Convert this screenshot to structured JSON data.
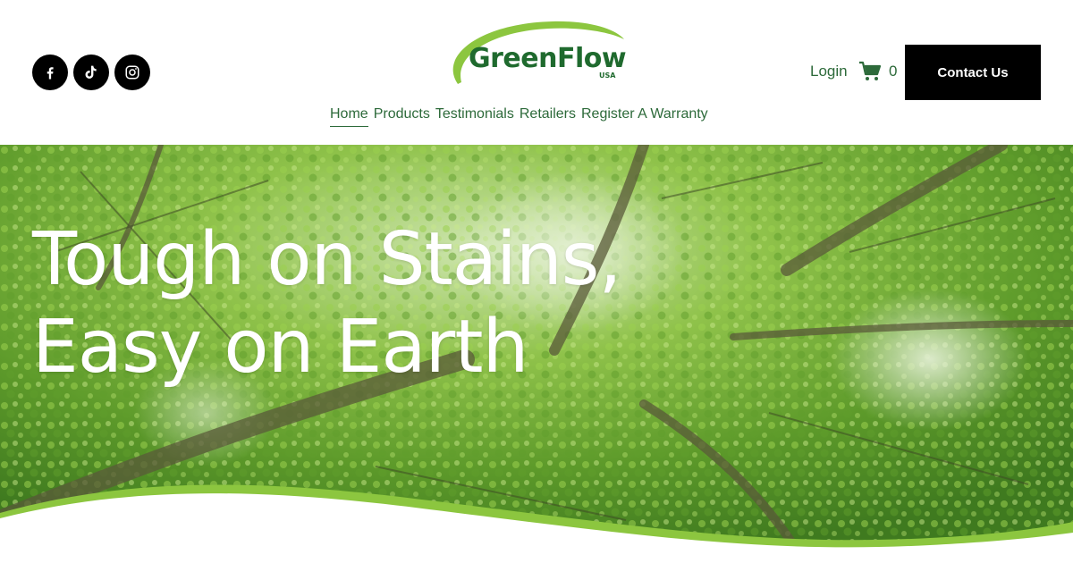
{
  "brand": {
    "name": "GreenFlow",
    "sub": "USA",
    "colors": {
      "primary": "#1f6a2e",
      "accent": "#8cc63f"
    }
  },
  "header": {
    "socials": [
      {
        "icon": "facebook-icon"
      },
      {
        "icon": "tiktok-icon"
      },
      {
        "icon": "instagram-icon"
      }
    ],
    "login_label": "Login",
    "cart_count": "0",
    "contact_label": "Contact Us"
  },
  "nav": {
    "items": [
      {
        "label": "Home",
        "active": true
      },
      {
        "label": "Products"
      },
      {
        "label": "Testimonials"
      },
      {
        "label": "Retailers"
      },
      {
        "label": "Register A Warranty"
      }
    ]
  },
  "hero": {
    "line1": "Tough on Stains,",
    "line2": "Easy on Earth"
  }
}
